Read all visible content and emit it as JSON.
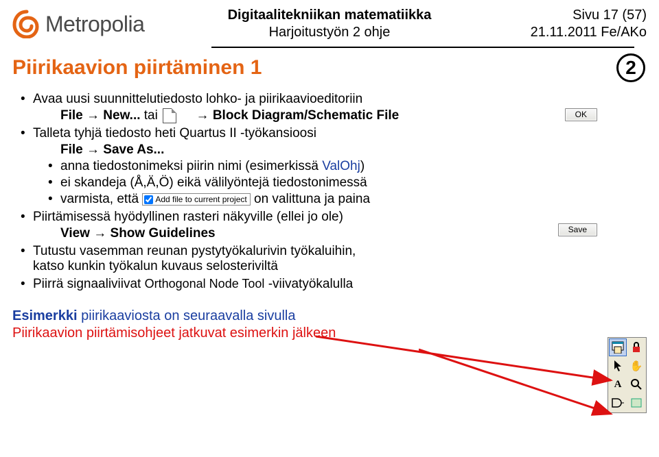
{
  "header": {
    "logo_text": "Metropolia",
    "center_line1": "Digitaalitekniikan matematiikka",
    "center_line2": "Harjoitustyön 2 ohje",
    "right_line1": "Sivu 17 (57)",
    "right_line2": "21.11.2011 Fe/AKo"
  },
  "badge": "2",
  "title": "Piirikaavion piirtäminen 1",
  "bullets": {
    "b1": "Avaa uusi suunnittelutiedosto lohko- ja piirikaavioeditoriin",
    "b1_sub_a": "File",
    "b1_sub_b": "New...",
    "b1_sub_c": " tai ",
    "b1_sub_d": "Block Diagram/Schematic File",
    "b2": "Talleta tyhjä tiedosto heti Quartus II -työkansioosi",
    "b2_sub_a": "File",
    "b2_sub_b": "Save As...",
    "b3_pre": "anna tiedostonimeksi piirin nimi (esimerkissä ",
    "b3_blue": "ValOhj",
    "b3_post": ")",
    "b4": "ei skandeja (Å,Ä,Ö) eikä välilyöntejä tiedostonimessä",
    "b5_a": "varmista, että ",
    "b5_b": " on valittuna ja paina",
    "b6": "Piirtämisessä hyödyllinen rasteri näkyville (ellei jo ole)",
    "b6_sub_a": "View",
    "b6_sub_b": "Show Guidelines",
    "b7_a": "Tutustu vasemman reunan pystytyökalurivin työkaluihin,",
    "b7_b": "katso kunkin työkalun kuvaus selosteriviltä",
    "b8_a": "Piirrä signaaliviivat ",
    "b8_b": "Orthogonal Node Tool",
    "b8_c": " -viivatyökalulla"
  },
  "buttons": {
    "ok": "OK",
    "save": "Save",
    "addfile": "Add file to current project"
  },
  "footer": {
    "line1_a": "Esimerkki",
    "line1_b": " piirikaaviosta on seuraavalla sivulla",
    "line2": "Piirikaavion piirtämisohjeet jatkuvat esimerkin jälkeen"
  },
  "arrow": "→"
}
